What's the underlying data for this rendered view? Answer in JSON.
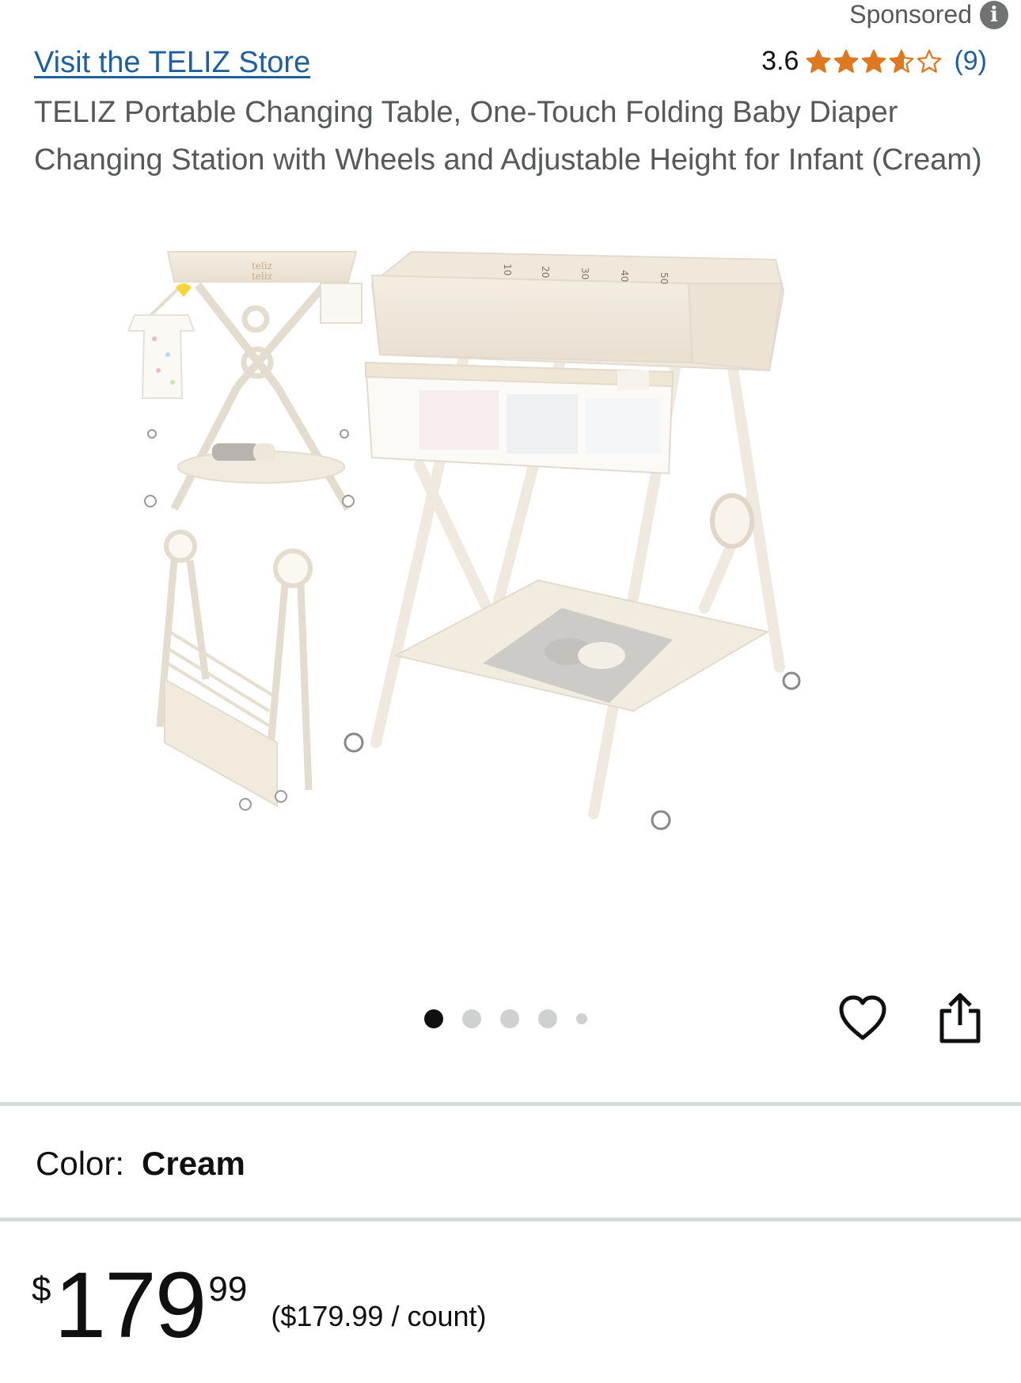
{
  "header": {
    "sponsored_label": "Sponsored",
    "info_icon": "info-icon"
  },
  "store": {
    "link_text": "Visit the TELIZ Store",
    "link_color": "#1f5f9e"
  },
  "rating": {
    "value": "3.6",
    "stars": 3.6,
    "max_stars": 5,
    "count": "(9)",
    "star_color": "#de7921"
  },
  "product": {
    "title": "TELIZ Portable Changing Table, One-Touch Folding Baby Diaper Changing Station with Wheels and Adjustable Height for Infant (Cream)"
  },
  "carousel": {
    "total_images": 5,
    "active_index": 0
  },
  "actions": {
    "wishlist_icon": "heart-outline-icon",
    "share_icon": "share-icon"
  },
  "color": {
    "label": "Color:",
    "value": "Cream"
  },
  "price": {
    "symbol": "$",
    "whole": "179",
    "fraction": "99",
    "unit_price": "($179.99 / count)"
  },
  "image_markings": {
    "ruler": [
      "10",
      "20",
      "30",
      "40",
      "50"
    ],
    "brand_mark": "teliz"
  }
}
